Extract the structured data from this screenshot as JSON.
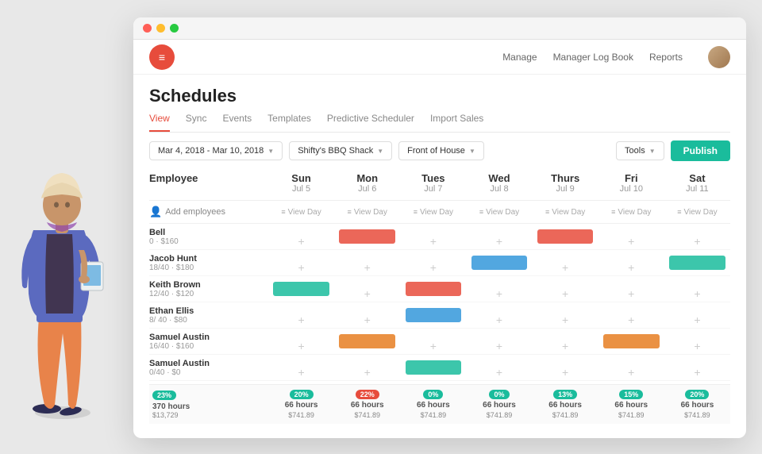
{
  "window": {
    "title": "Schedules"
  },
  "topnav": {
    "manage": "Manage",
    "manager_log_book": "Manager Log Book",
    "reports": "Reports"
  },
  "tabs": [
    {
      "label": "View",
      "active": true
    },
    {
      "label": "Sync",
      "active": false
    },
    {
      "label": "Events",
      "active": false
    },
    {
      "label": "Templates",
      "active": false
    },
    {
      "label": "Predictive Scheduler",
      "active": false
    },
    {
      "label": "Import Sales",
      "active": false
    }
  ],
  "toolbar": {
    "date_range": "Mar 4, 2018 - Mar 10, 2018",
    "location": "Shifty's BBQ Shack",
    "department": "Front of House",
    "tools": "Tools",
    "publish": "Publish"
  },
  "grid": {
    "employee_col": "Employee",
    "add_employees": "Add employees",
    "days": [
      {
        "name": "Sun",
        "date": "Jul 5"
      },
      {
        "name": "Mon",
        "date": "Jul 6"
      },
      {
        "name": "Tues",
        "date": "Jul 7"
      },
      {
        "name": "Wed",
        "date": "Jul 8"
      },
      {
        "name": "Thurs",
        "date": "Jul 9"
      },
      {
        "name": "Fri",
        "date": "Jul 10"
      },
      {
        "name": "Sat",
        "date": "Jul 11"
      }
    ],
    "view_day_label": "View Day",
    "employees": [
      {
        "name": "Bell",
        "hours": "0 · $160",
        "shifts": [
          null,
          "red",
          null,
          null,
          "red",
          null,
          null
        ]
      },
      {
        "name": "Jacob Hunt",
        "hours": "18/40 · $180",
        "shifts": [
          null,
          null,
          null,
          "blue",
          null,
          null,
          "teal"
        ]
      },
      {
        "name": "Keith Brown",
        "hours": "12/40 · $120",
        "shifts": [
          "teal",
          null,
          "red",
          null,
          null,
          null,
          null
        ]
      },
      {
        "name": "Ethan Ellis",
        "hours": "8/ 40 · $80",
        "shifts": [
          null,
          null,
          "blue",
          null,
          null,
          null,
          null
        ]
      },
      {
        "name": "Samuel Austin",
        "hours": "16/40 · $160",
        "shifts": [
          null,
          "orange",
          null,
          null,
          null,
          "orange",
          null
        ]
      },
      {
        "name": "Samuel Austin",
        "hours": "0/40 · $0",
        "shifts": [
          null,
          null,
          "teal",
          null,
          null,
          null,
          null
        ]
      }
    ]
  },
  "summary": {
    "first_col": {
      "badge1": "23%",
      "badge1_color": "green",
      "label1": "370 hours",
      "label2": "$13,729"
    },
    "cols": [
      {
        "badge": "20%",
        "badge_color": "green",
        "hours": "66 hours",
        "money": "$741.89"
      },
      {
        "badge": "22%",
        "badge_color": "red",
        "hours": "66 hours",
        "money": "$741.89"
      },
      {
        "badge": "0%",
        "badge_color": "green",
        "hours": "66 hours",
        "money": "$741.89"
      },
      {
        "badge": "0%",
        "badge_color": "green",
        "hours": "66 hours",
        "money": "$741.89"
      },
      {
        "badge": "13%",
        "badge_color": "green",
        "hours": "66 hours",
        "money": "$741.89"
      },
      {
        "badge": "15%",
        "badge_color": "green",
        "hours": "66 hours",
        "money": "$741.89"
      },
      {
        "badge": "20%",
        "badge_color": "green",
        "hours": "66 hours",
        "money": "$741.89"
      }
    ]
  },
  "colors": {
    "red": "#e74c3c",
    "teal": "#1abc9c",
    "blue": "#3498db",
    "orange": "#e67e22",
    "accent": "#1abc9c"
  }
}
